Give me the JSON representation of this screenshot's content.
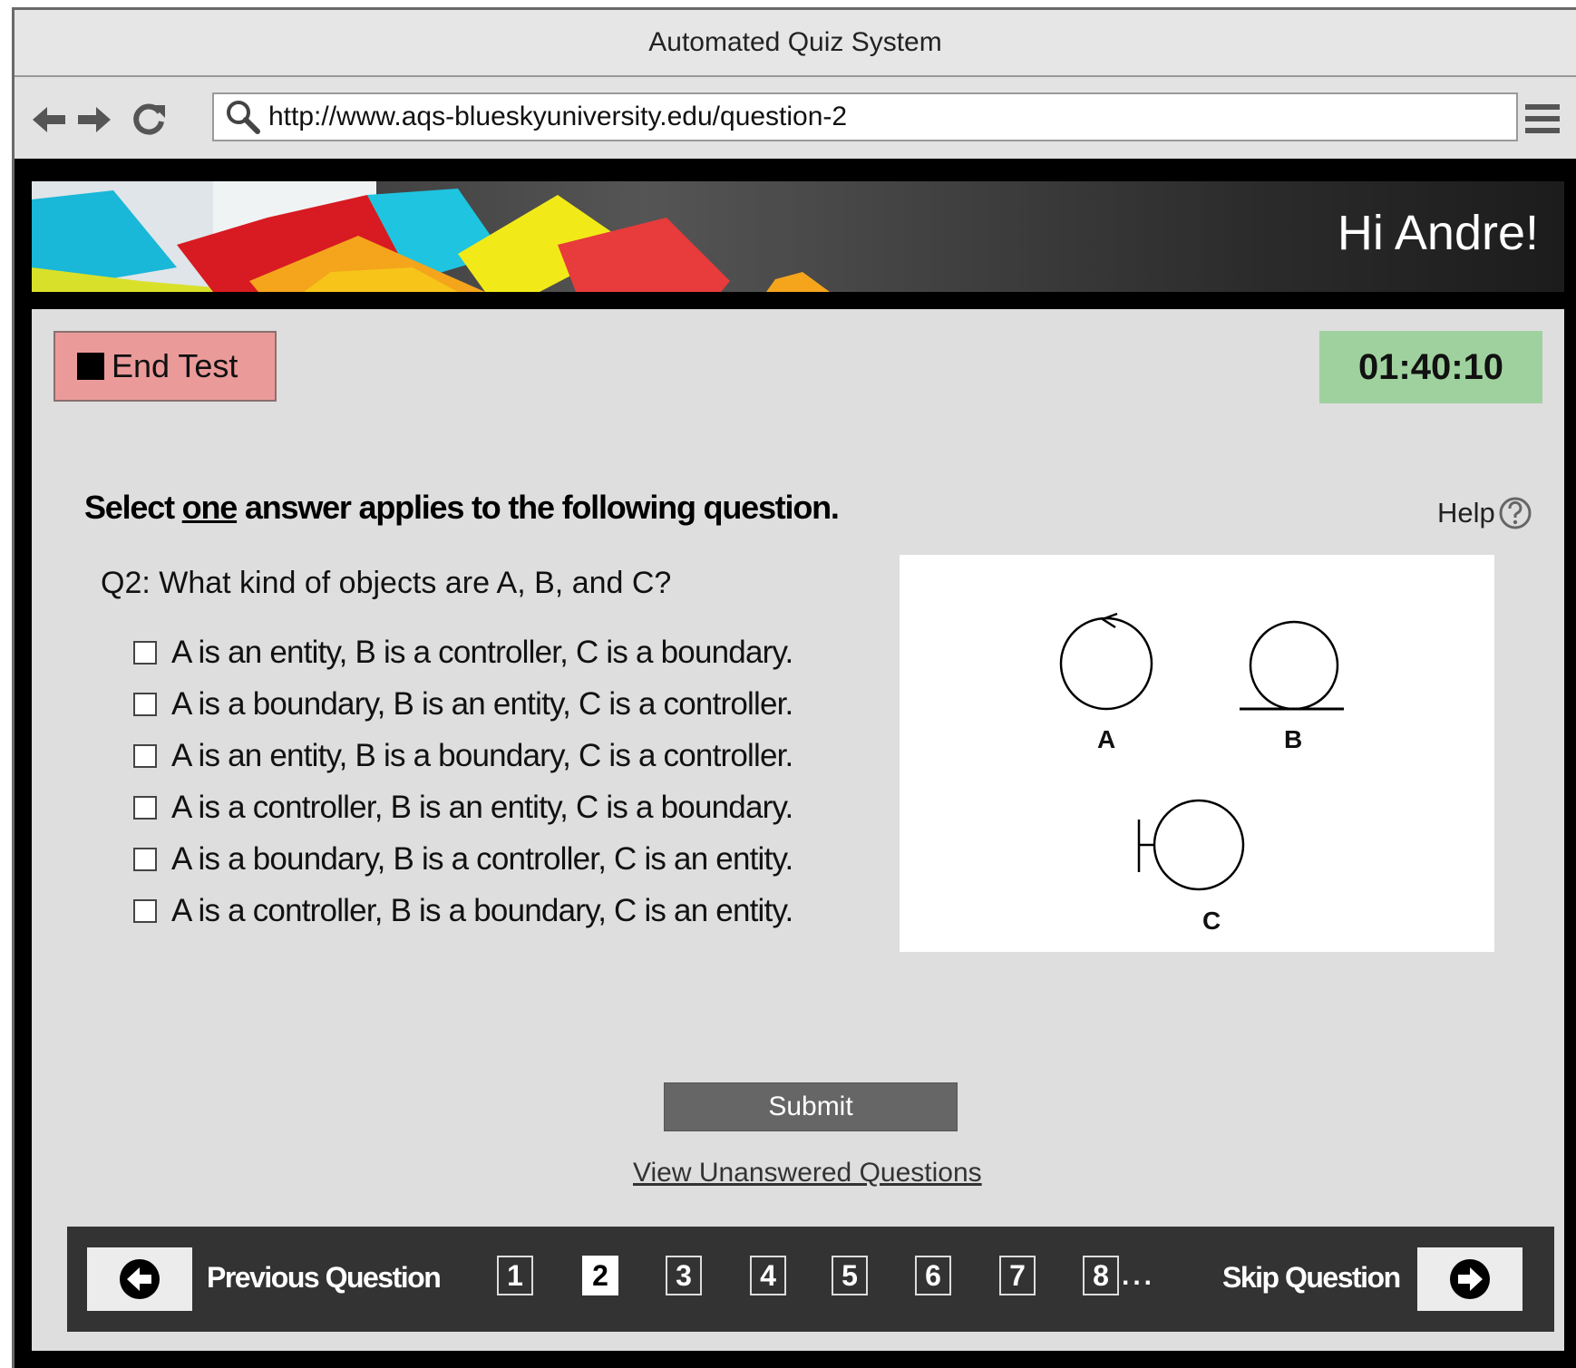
{
  "window": {
    "title": "Automated Quiz System"
  },
  "browser": {
    "url": "http://www.aqs-blueskyuniversity.edu/question-2",
    "icons": [
      "back-arrow-icon",
      "forward-arrow-icon",
      "reload-icon",
      "search-icon",
      "hamburger-menu-icon"
    ]
  },
  "header": {
    "greeting": "Hi Andre!"
  },
  "toolbar": {
    "end_test_label": "End Test",
    "timer": "01:40:10"
  },
  "instruction": {
    "prefix": "Select ",
    "emphasis": "one",
    "suffix": " answer applies to the following question."
  },
  "help": {
    "label": "Help"
  },
  "question": {
    "text": "Q2: What kind of objects are A, B, and C?",
    "options": [
      "A is an entity, B is a controller, C is a boundary.",
      "A is a boundary, B is an entity, C is a controller.",
      "A is an entity, B is a boundary, C is a controller.",
      "A is a controller, B is an entity, C is a boundary.",
      "A is a boundary, B is a controller, C is an entity.",
      "A is a controller, B is a boundary, C is an entity."
    ],
    "figure_labels": {
      "a": "A",
      "b": "B",
      "c": "C"
    }
  },
  "actions": {
    "submit_label": "Submit",
    "unanswered_link": "View Unanswered Questions"
  },
  "pager": {
    "previous_label": "Previous Question",
    "skip_label": "Skip Question",
    "pages": [
      "1",
      "2",
      "3",
      "4",
      "5",
      "6",
      "7",
      "8"
    ],
    "current_page": "2",
    "ellipsis": "..."
  }
}
